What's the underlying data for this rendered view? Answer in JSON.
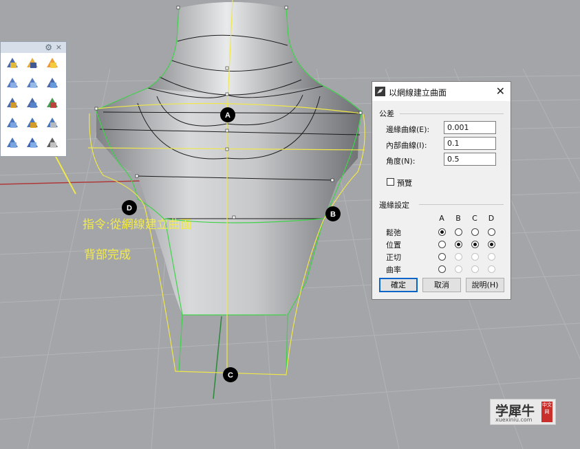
{
  "toolbar": {
    "gear_glyph": "⚙",
    "close_glyph": "×",
    "tools": [
      "plane-tool-icon",
      "puzzle-surface-icon",
      "explode-icon",
      "network-surface-icon",
      "sweep-icon",
      "patch-icon",
      "transform-icon",
      "extend-icon",
      "texture-icon",
      "cone-icon",
      "curve-icon",
      "sphere-icon",
      "head-icon",
      "gradient-icon",
      "grid-icon"
    ]
  },
  "viewport": {
    "markers": {
      "a": "A",
      "b": "B",
      "c": "C",
      "d": "D"
    },
    "annotation_command": "指令:從網線建立曲面",
    "annotation_status": "背部完成"
  },
  "dialog": {
    "title": "以網線建立曲面",
    "close_glyph": "✕",
    "tolerance_section": "公差",
    "edge_label": "邊緣曲線(E):",
    "edge_value": "0.001",
    "inner_label": "內部曲線(I):",
    "inner_value": "0.1",
    "angle_label": "角度(N):",
    "angle_value": "0.5",
    "preview_label": "預覽",
    "edge_settings_section": "邊緣設定",
    "columns": [
      "A",
      "B",
      "C",
      "D"
    ],
    "rows": [
      {
        "label": "鬆弛",
        "states": [
          "on",
          "off",
          "off",
          "off"
        ]
      },
      {
        "label": "位置",
        "states": [
          "off",
          "on",
          "on",
          "on"
        ]
      },
      {
        "label": "正切",
        "states": [
          "off",
          "disabled",
          "disabled",
          "disabled"
        ]
      },
      {
        "label": "曲率",
        "states": [
          "off",
          "disabled",
          "disabled",
          "disabled"
        ]
      }
    ],
    "ok_label": "確定",
    "cancel_label": "取消",
    "help_label": "說明(H)"
  },
  "watermark": {
    "main": "学犀牛",
    "sub": "xuexiniu.com",
    "tag": "中文网"
  }
}
